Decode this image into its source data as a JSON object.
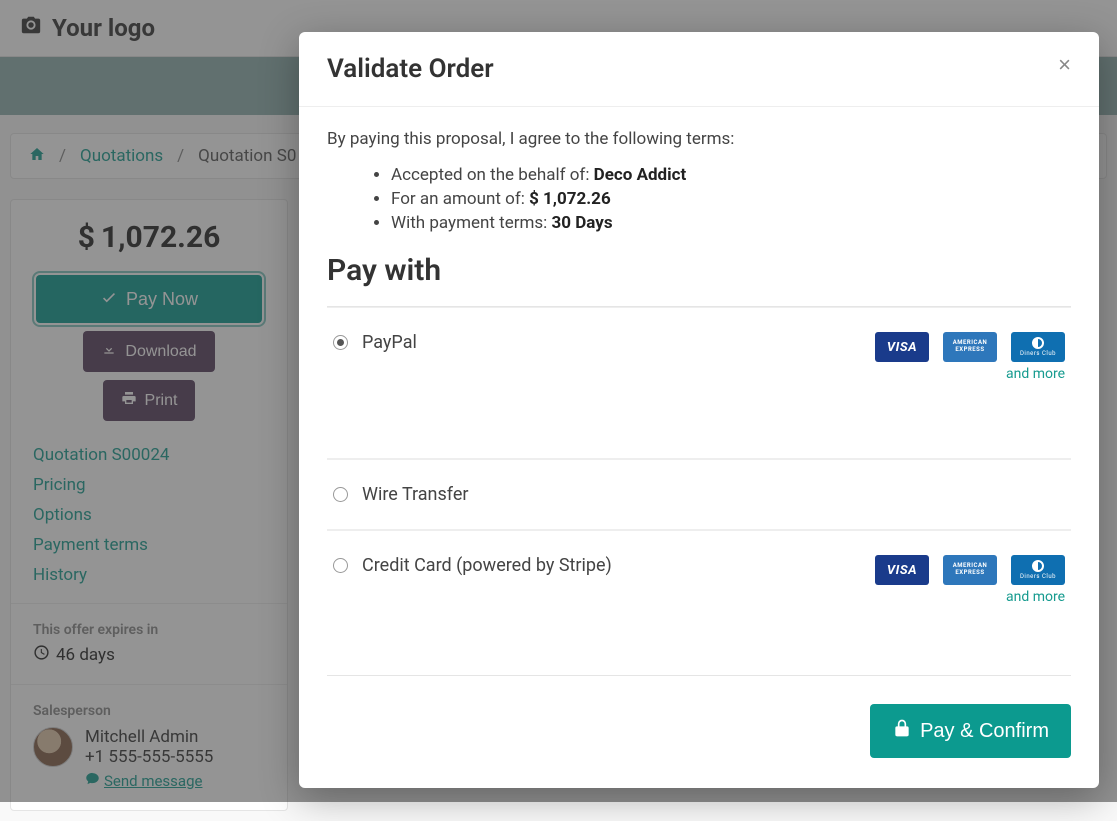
{
  "header": {
    "logo_text": "Your logo"
  },
  "breadcrumb": {
    "quotations_label": "Quotations",
    "current_label": "Quotation S0"
  },
  "panel": {
    "currency": "$",
    "amount": "1,072.26",
    "pay_now_label": "Pay Now",
    "download_label": "Download",
    "print_label": "Print",
    "nav_items": [
      "Quotation S00024",
      "Pricing",
      "Options",
      "Payment terms",
      "History"
    ],
    "expires_label": "This offer expires in",
    "expires_value": "46 days",
    "salesperson_label": "Salesperson",
    "salesperson_name": "Mitchell Admin",
    "salesperson_phone": "+1 555-555-5555",
    "send_message_label": "Send message"
  },
  "modal": {
    "title": "Validate Order",
    "terms_intro": "By paying this proposal, I agree to the following terms:",
    "term_accepted_prefix": "Accepted on the behalf of: ",
    "term_accepted_value": "Deco Addict",
    "term_amount_prefix": "For an amount of: ",
    "term_amount_value": "$ 1,072.26",
    "term_payment_prefix": "With payment terms: ",
    "term_payment_value": "30 Days",
    "pay_with_heading": "Pay with",
    "payment_methods": [
      {
        "label": "PayPal",
        "checked": true,
        "has_cards": true
      },
      {
        "label": "Wire Transfer",
        "checked": false,
        "has_cards": false
      },
      {
        "label": "Credit Card (powered by Stripe)",
        "checked": false,
        "has_cards": true
      }
    ],
    "and_more_label": "and more",
    "confirm_label": "Pay & Confirm",
    "card_visa": "VISA",
    "card_amex": "AMERICAN EXPRESS",
    "card_diners": "Diners Club"
  }
}
